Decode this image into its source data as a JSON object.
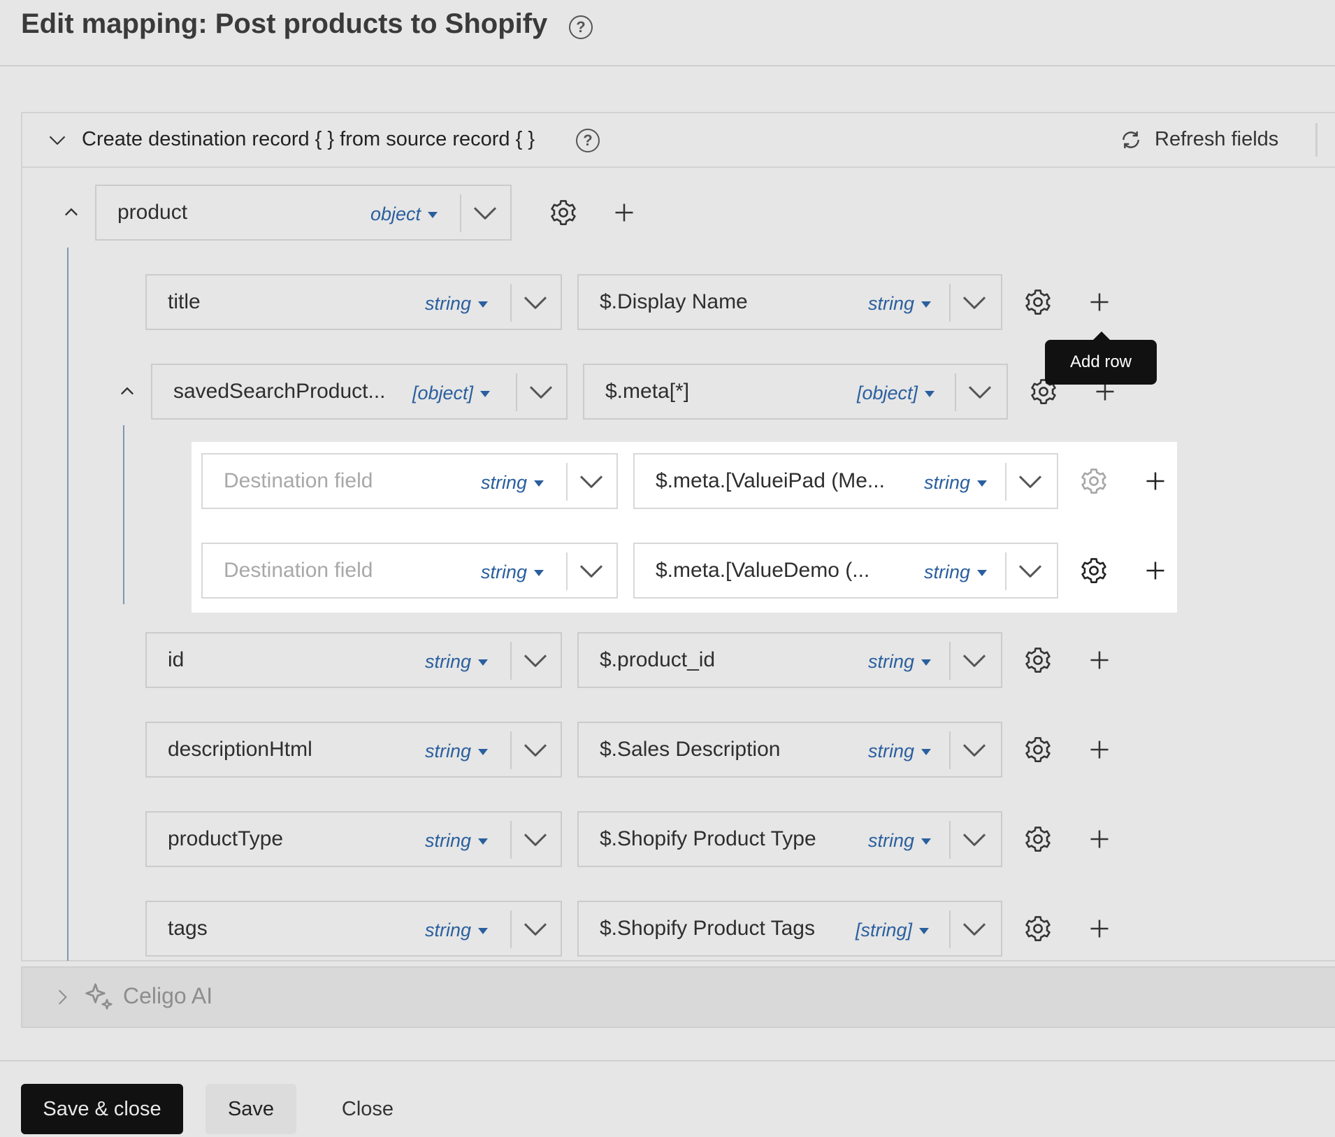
{
  "page": {
    "title": "Edit mapping: Post products to Shopify"
  },
  "section": {
    "title": "Create destination record { } from source record { }",
    "refresh_label": "Refresh fields"
  },
  "rows": {
    "product": {
      "dest": "product",
      "dest_type": "object"
    },
    "title": {
      "dest": "title",
      "dest_type": "string",
      "src": "$.Display Name",
      "src_type": "string"
    },
    "saved": {
      "dest": "savedSearchProduct...",
      "dest_type": "[object]",
      "src": "$.meta[*]",
      "src_type": "[object]"
    },
    "meta1": {
      "dest_placeholder": "Destination field",
      "dest_type": "string",
      "src": "$.meta.[ValueiPad (Me...",
      "src_type": "string"
    },
    "meta2": {
      "dest_placeholder": "Destination field",
      "dest_type": "string",
      "src": "$.meta.[ValueDemo (...",
      "src_type": "string"
    },
    "id": {
      "dest": "id",
      "dest_type": "string",
      "src": "$.product_id",
      "src_type": "string"
    },
    "desc": {
      "dest": "descriptionHtml",
      "dest_type": "string",
      "src": "$.Sales Description",
      "src_type": "string"
    },
    "ptype": {
      "dest": "productType",
      "dest_type": "string",
      "src": "$.Shopify Product Type",
      "src_type": "string"
    },
    "tags": {
      "dest": "tags",
      "dest_type": "string",
      "src": "$.Shopify Product Tags",
      "src_type": "[string]"
    }
  },
  "tooltip": {
    "text": "Add row"
  },
  "ai": {
    "label": "Celigo AI"
  },
  "footer": {
    "save_close": "Save & close",
    "save": "Save",
    "close": "Close"
  },
  "icons": {
    "help": "question-circle-icon",
    "collapse": "chevron-down-icon",
    "refresh": "refresh-icon",
    "settings": "gear-icon",
    "add": "plus-icon",
    "ai": "sparkle-icon"
  }
}
